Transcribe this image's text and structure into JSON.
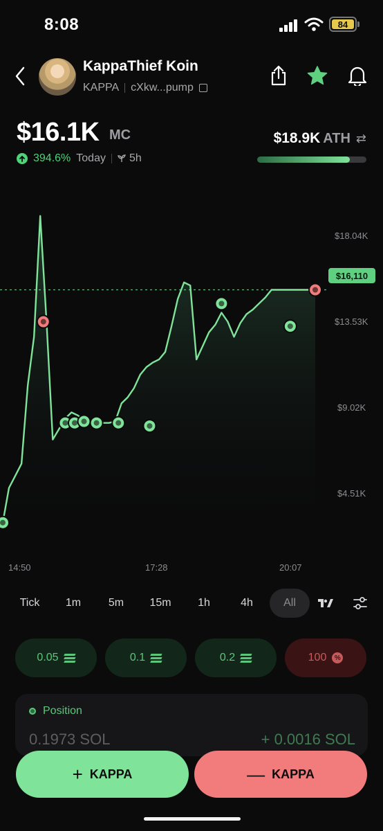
{
  "status_bar": {
    "time": "8:08",
    "battery": "84"
  },
  "header": {
    "token_name": "KappaThief Koin",
    "ticker": "KAPPA",
    "address": "cXkw...pump"
  },
  "market": {
    "mc_value": "$16.1K",
    "mc_suffix": "MC",
    "change_pct": "394.6%",
    "change_label": "Today",
    "age": "5h",
    "ath_value": "$18.9K",
    "ath_label": "ATH",
    "ath_progress": 0.85
  },
  "chart": {
    "y_labels": [
      "$18.04K",
      "$13.53K",
      "$9.02K",
      "$4.51K"
    ],
    "current_price_tag": "$16,110",
    "x_labels": [
      "14:50",
      "17:28",
      "20:07"
    ],
    "line_color": "#7fe39a",
    "buy_color": "#7fe39a",
    "sell_color": "#f27b7b"
  },
  "chart_data": {
    "type": "line",
    "title": "",
    "xlabel": "",
    "ylabel": "",
    "ylim": [
      0,
      22000
    ],
    "y_ticks": [
      "$4.51K",
      "$9.02K",
      "$13.53K",
      "$18.04K"
    ],
    "x_ticks": [
      "14:50",
      "17:28",
      "20:07"
    ],
    "series": [
      {
        "x": [
          0,
          2,
          4,
          6,
          8,
          10,
          12,
          14,
          16,
          18,
          20,
          22,
          24,
          26,
          28,
          30,
          32,
          34,
          36,
          38,
          40,
          42,
          44,
          46,
          48,
          50,
          52,
          54,
          56,
          58,
          60,
          62,
          64,
          66,
          68,
          70,
          72,
          74,
          76,
          78,
          80,
          82,
          84,
          86,
          88,
          90,
          92,
          94,
          96,
          98,
          100
        ],
        "values": [
          700,
          3000,
          3800,
          4600,
          9800,
          13000,
          21000,
          14000,
          6200,
          6900,
          7600,
          8000,
          7800,
          7500,
          7400,
          7300,
          7300,
          7300,
          7400,
          8600,
          9000,
          9600,
          10500,
          11000,
          11300,
          11500,
          12000,
          13700,
          15500,
          16600,
          16400,
          11500,
          12400,
          13300,
          13800,
          14600,
          14000,
          13000,
          13900,
          14500,
          14800,
          15200,
          15600,
          16110,
          16110,
          16110,
          16110,
          16110,
          16110,
          16110,
          16110
        ]
      }
    ],
    "current_price": 16110,
    "trade_markers": [
      {
        "kind": "buy",
        "x": 0,
        "y": 700
      },
      {
        "kind": "sell",
        "x": 13,
        "y": 14000
      },
      {
        "kind": "buy",
        "x": 20,
        "y": 7300
      },
      {
        "kind": "buy",
        "x": 23,
        "y": 7300
      },
      {
        "kind": "buy",
        "x": 26,
        "y": 7400
      },
      {
        "kind": "buy",
        "x": 30,
        "y": 7300
      },
      {
        "kind": "buy",
        "x": 37,
        "y": 7300
      },
      {
        "kind": "buy",
        "x": 47,
        "y": 7100
      },
      {
        "kind": "buy",
        "x": 70,
        "y": 15200
      },
      {
        "kind": "buy",
        "x": 92,
        "y": 13700
      },
      {
        "kind": "sell",
        "x": 100,
        "y": 16110
      }
    ]
  },
  "timeframes": [
    "Tick",
    "1m",
    "5m",
    "15m",
    "1h",
    "4h",
    "All"
  ],
  "timeframe_active": "All",
  "quick_buys": [
    {
      "label": "0.05",
      "kind": "green"
    },
    {
      "label": "0.1",
      "kind": "green"
    },
    {
      "label": "0.2",
      "kind": "green"
    },
    {
      "label": "100",
      "kind": "red"
    }
  ],
  "position": {
    "title": "Position",
    "amount": "0.1973 SOL",
    "pnl": "+ 0.0016 SOL"
  },
  "actions": {
    "buy_label": "KAPPA",
    "buy_symbol": "+",
    "sell_label": "KAPPA",
    "sell_symbol": "—"
  }
}
